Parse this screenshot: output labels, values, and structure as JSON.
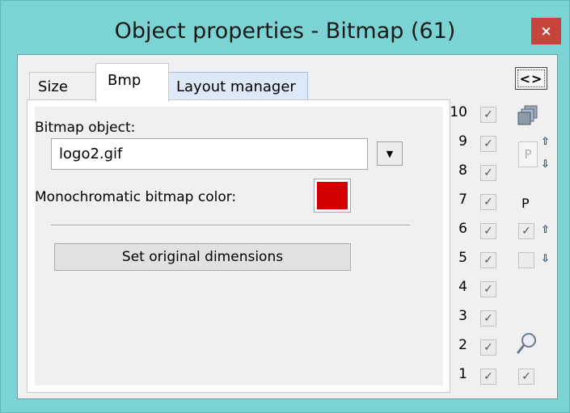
{
  "window": {
    "title": "Object properties - Bitmap (61)",
    "close_symbol": "×"
  },
  "tabs": [
    {
      "label": "Size"
    },
    {
      "label": "Bmp"
    },
    {
      "label": "Layout manager"
    }
  ],
  "bmp_panel": {
    "bitmap_label": "Bitmap object:",
    "bitmap_value": "logo2.gif",
    "dropdown_symbol": "▼",
    "mono_label": "Monochromatic bitmap color:",
    "mono_color": "#d40000",
    "set_button_label": "Set original dimensions"
  },
  "side_panel": {
    "code_button_label": "<>",
    "layers": [
      {
        "num": "10",
        "checked": true
      },
      {
        "num": "9",
        "checked": true
      },
      {
        "num": "8",
        "checked": true
      },
      {
        "num": "7",
        "checked": true
      },
      {
        "num": "6",
        "checked": true
      },
      {
        "num": "5",
        "checked": true
      },
      {
        "num": "4",
        "checked": true
      },
      {
        "num": "3",
        "checked": true
      },
      {
        "num": "2",
        "checked": true
      },
      {
        "num": "1",
        "checked": true
      }
    ],
    "p_box_label": "P",
    "p_label": "P",
    "arrow_up": "⇧",
    "arrow_down": "⇩",
    "check_mark": "✓",
    "icons": [
      "layers-icon",
      "move-layer-icon",
      "zoom-icon"
    ]
  }
}
